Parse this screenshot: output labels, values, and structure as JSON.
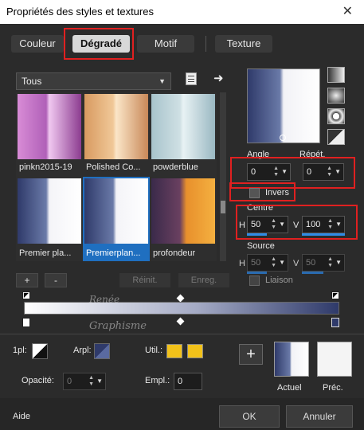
{
  "window": {
    "title": "Propriétés des styles et textures",
    "close_glyph": "✕"
  },
  "tabs": [
    {
      "label": "Couleur"
    },
    {
      "label": "Dégradé"
    },
    {
      "label": "Motif"
    },
    {
      "label": "Texture"
    }
  ],
  "library": {
    "category": "Tous",
    "items": [
      {
        "label": "pinkn2015-19"
      },
      {
        "label": "Polished Co..."
      },
      {
        "label": "powderblue"
      },
      {
        "label": "Premier pla..."
      },
      {
        "label": "Premierplan..."
      },
      {
        "label": "profondeur"
      }
    ],
    "add_label": "+",
    "remove_label": "-",
    "reset_label": "Réinit.",
    "save_label": "Enreg."
  },
  "options": {
    "angle_label": "Angle",
    "angle_value": "0",
    "repeat_label": "Répét.",
    "repeat_value": "0",
    "invert_label": "Invers",
    "center_label": "Centre",
    "center_h_label": "H",
    "center_h_value": "50",
    "center_v_label": "V",
    "center_v_value": "100",
    "source_label": "Source",
    "source_h_label": "H",
    "source_h_value": "50",
    "source_v_label": "V",
    "source_v_value": "50",
    "link_label": "Liaison"
  },
  "watermark": {
    "line1": "Renée",
    "line2": "Graphisme"
  },
  "point": {
    "pl_label": "1pl:",
    "arpl_label": "Arpl:",
    "util_label": "Util.:",
    "opacity_label": "Opacité:",
    "opacity_value": "0",
    "empl_label": "Empl.:",
    "empl_value": "0"
  },
  "preview": {
    "current_label": "Actuel",
    "previous_label": "Préc."
  },
  "footer": {
    "help_label": "Aide",
    "ok_label": "OK",
    "cancel_label": "Annuler"
  },
  "colors": {
    "navy": "#2f3a6a",
    "gold": "#f2c21a",
    "accent": "#2f8ce6",
    "highlight": "#e02020"
  }
}
